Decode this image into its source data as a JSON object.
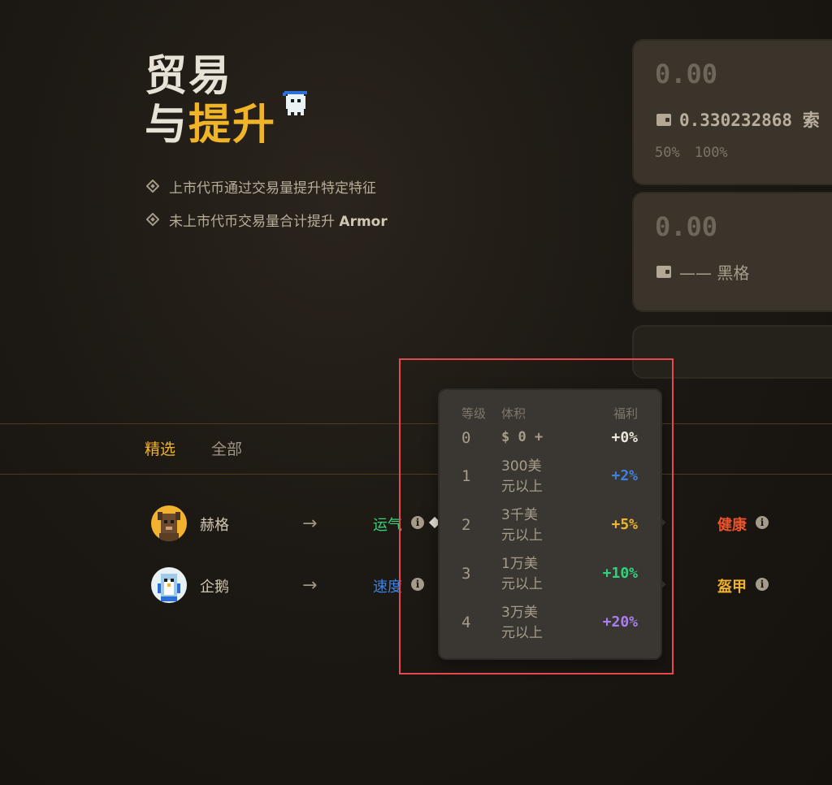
{
  "hero": {
    "title_line1": "贸易",
    "title_line2_plain": "与",
    "title_line2_accent": "提升",
    "bullets": [
      {
        "text": "上市代币通过交易量提升特定特征",
        "bold": ""
      },
      {
        "text": "未上市代币交易量合计提升 ",
        "bold": "Armor"
      }
    ]
  },
  "cards": [
    {
      "amount": "0.00",
      "wallet_text": "0.330232868 索",
      "percents": [
        "50%",
        "100%"
      ]
    },
    {
      "amount": "0.00",
      "wallet_text": "—— 黑格"
    }
  ],
  "tabs": [
    {
      "label": "精选",
      "active": true
    },
    {
      "label": "全部",
      "active": false
    }
  ],
  "rows": [
    {
      "name": "赫格",
      "arrow": "→",
      "stat_from": "运气",
      "stat_from_color": "#3fd17a",
      "stat_to": "健康",
      "stat_to_color": "#e8542c",
      "info": "i"
    },
    {
      "name": "企鹅",
      "arrow": "→",
      "stat_from": "速度",
      "stat_from_color": "#3d82e0",
      "stat_to": "盔甲",
      "stat_to_color": "#f0b429",
      "info": "i"
    }
  ],
  "tooltip": {
    "headers": {
      "level": "等级",
      "volume": "体积",
      "benefit": "福利"
    },
    "rows": [
      {
        "level": "0",
        "volume_line1": "$ 0 +",
        "volume_line2": "",
        "benefit": "+0%",
        "color": "#ece6da"
      },
      {
        "level": "1",
        "volume_line1": "300美",
        "volume_line2": "元以上",
        "benefit": "+2%",
        "color": "#3d82e0"
      },
      {
        "level": "2",
        "volume_line1": "3千美",
        "volume_line2": "元以上",
        "benefit": "+5%",
        "color": "#f0b429"
      },
      {
        "level": "3",
        "volume_line1": "1万美",
        "volume_line2": "元以上",
        "benefit": "+10%",
        "color": "#2fd37c"
      },
      {
        "level": "4",
        "volume_line1": "3万美",
        "volume_line2": "元以上",
        "benefit": "+20%",
        "color": "#a97ff0"
      }
    ]
  },
  "colors": {
    "accent": "#f0b429",
    "highlight": "#e5484d"
  }
}
